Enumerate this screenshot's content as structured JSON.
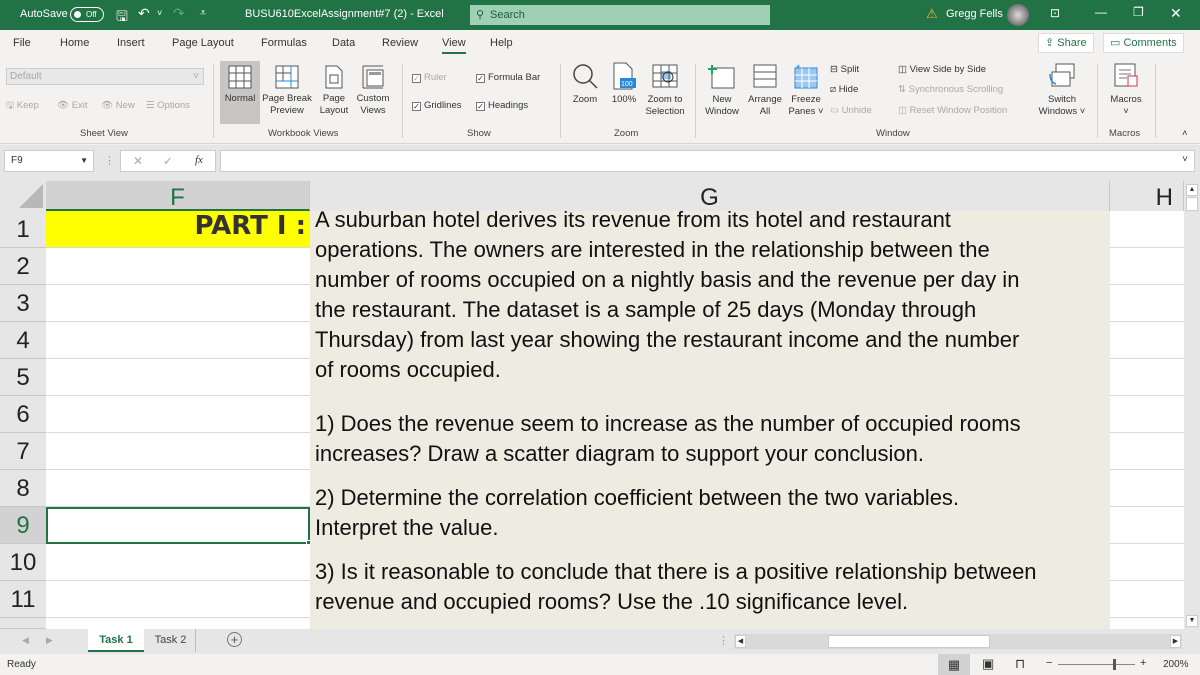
{
  "titlebar": {
    "autosave_label": "AutoSave",
    "autosave_state": "Off",
    "title": "BUSU610ExcelAssignment#7 (2)  -  Excel",
    "search_placeholder": "Search",
    "user_name": "Gregg Fells",
    "accent": "#217346"
  },
  "menu": {
    "tabs": [
      "File",
      "Home",
      "Insert",
      "Page Layout",
      "Formulas",
      "Data",
      "Review",
      "View",
      "Help"
    ],
    "active_tab": "View",
    "share_label": "Share",
    "comments_label": "Comments"
  },
  "ribbon": {
    "sheet_view": {
      "dropdown_value": "Default",
      "keep": "Keep",
      "exit": "Exit",
      "new": "New",
      "options": "Options",
      "group_label": "Sheet View"
    },
    "workbook_views": {
      "normal": "Normal",
      "page_break": [
        "Page Break",
        "Preview"
      ],
      "page_layout": [
        "Page",
        "Layout"
      ],
      "custom_views": [
        "Custom",
        "Views"
      ],
      "group_label": "Workbook Views"
    },
    "show": {
      "ruler": "Ruler",
      "formula_bar": "Formula Bar",
      "gridlines": "Gridlines",
      "headings": "Headings",
      "ruler_checked": true,
      "formula_bar_checked": true,
      "gridlines_checked": true,
      "headings_checked": true,
      "group_label": "Show"
    },
    "zoom": {
      "zoom": "Zoom",
      "hundred": "100%",
      "hundred_icon": "100",
      "zoom_selection": [
        "Zoom to",
        "Selection"
      ],
      "group_label": "Zoom"
    },
    "window": {
      "new_window": [
        "New",
        "Window"
      ],
      "arrange_all": [
        "Arrange",
        "All"
      ],
      "freeze_panes": [
        "Freeze",
        "Panes ˅"
      ],
      "split": "Split",
      "hide": "Hide",
      "unhide": "Unhide",
      "view_side": "View Side by Side",
      "sync_scroll": "Synchronous Scrolling",
      "reset_pos": "Reset Window Position",
      "switch": [
        "Switch",
        "Windows ˅"
      ],
      "group_label": "Window"
    },
    "macros": {
      "label": "Macros",
      "group_label": "Macros"
    }
  },
  "formula_bar": {
    "name_box": "F9",
    "fx": "fx",
    "value": ""
  },
  "sheet": {
    "columns": [
      "F",
      "G",
      "H"
    ],
    "rows": [
      "1",
      "2",
      "3",
      "4",
      "5",
      "6",
      "7",
      "8",
      "9",
      "10",
      "11"
    ],
    "selected_cell": "F9",
    "f1_text": "PART I :",
    "f1_fill": "#ffff00",
    "paragraph": [
      "A suburban hotel derives its revenue from its hotel and restaurant",
      "operations. The owners are interested in the relationship between the",
      "number of rooms occupied on a nightly basis and the revenue per day in",
      "the restaurant. The dataset is a sample of 25 days (Monday through",
      "Thursday) from last year showing the restaurant income and the number",
      "of rooms occupied."
    ],
    "q1": [
      "1) Does the revenue seem to increase as the number of occupied rooms",
      "increases? Draw a scatter diagram to support your conclusion."
    ],
    "q2": [
      "2) Determine the correlation coefficient between the two variables.",
      "Interpret the value."
    ],
    "q3": [
      "3) Is it reasonable to conclude that there is a positive relationship between",
      "revenue and occupied rooms? Use the .10 significance level."
    ]
  },
  "sheet_tabs": {
    "tabs": [
      "Task 1",
      "Task 2"
    ],
    "active": "Task 1"
  },
  "status": {
    "text": "Ready",
    "zoom": "200%",
    "zoom_minus": "−",
    "zoom_plus": "+"
  }
}
